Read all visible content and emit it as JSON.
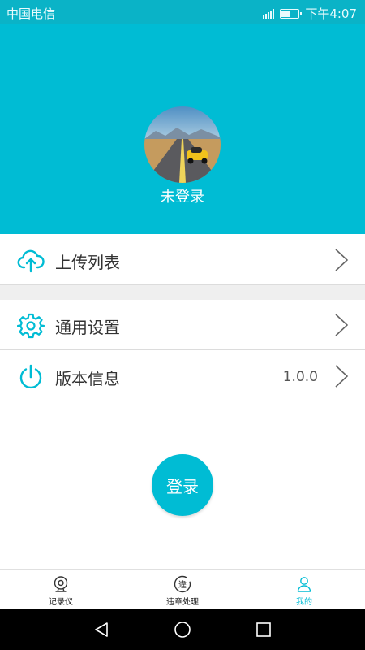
{
  "status_bar": {
    "carrier": "中国电信",
    "time": "下午4:07"
  },
  "profile": {
    "login_status": "未登录"
  },
  "menu": {
    "upload_list": {
      "label": "上传列表"
    },
    "general_settings": {
      "label": "通用设置"
    },
    "version_info": {
      "label": "版本信息",
      "value": "1.0.0"
    }
  },
  "login_button": {
    "label": "登录"
  },
  "tab_bar": {
    "tabs": [
      {
        "label": "记录仪",
        "icon": "dashcam-icon"
      },
      {
        "label": "违章处理",
        "icon": "violation-icon"
      },
      {
        "label": "我的",
        "icon": "person-icon",
        "active": true
      }
    ]
  },
  "colors": {
    "primary": "#00bcd4",
    "status_bar": "#0ab3c7",
    "divider": "#dcdcdc",
    "section_gap": "#efefef"
  }
}
